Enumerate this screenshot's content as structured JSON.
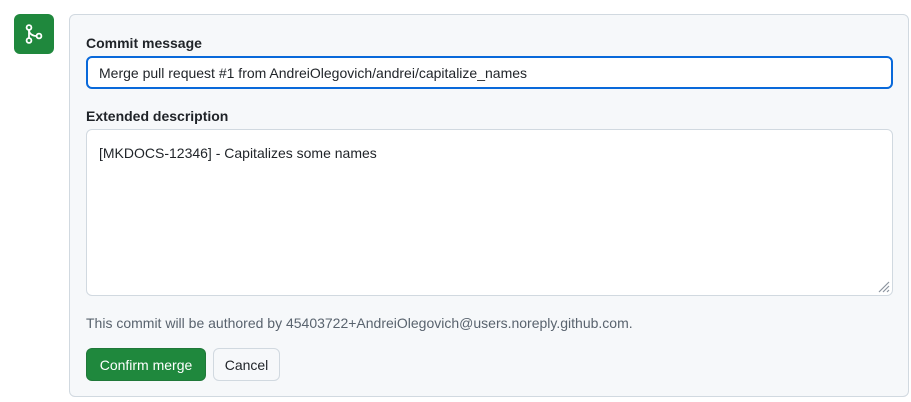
{
  "icons": {
    "merge_badge": "git-merge-icon",
    "resize": "resize-grip-icon"
  },
  "colors": {
    "accent_green": "#1f883d",
    "focus_blue": "#0969da",
    "muted_text": "#59636e"
  },
  "commit_message": {
    "label": "Commit message",
    "value": "Merge pull request #1 from AndreiOlegovich/andrei/capitalize_names"
  },
  "extended_description": {
    "label": "Extended description",
    "value": "[MKDOCS-12346] - Capitalizes some names"
  },
  "author_note": "This commit will be authored by 45403722+AndreiOlegovich@users.noreply.github.com.",
  "actions": {
    "confirm_label": "Confirm merge",
    "cancel_label": "Cancel"
  }
}
